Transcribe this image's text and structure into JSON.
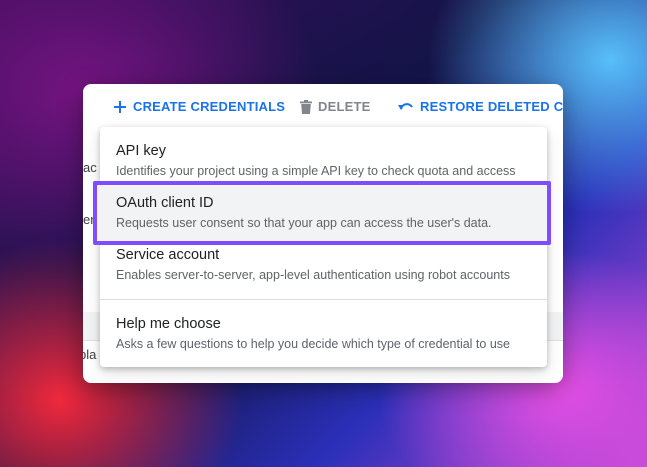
{
  "toolbar": {
    "create_label": "CREATE CREDENTIALS",
    "delete_label": "DELETE",
    "restore_label": "RESTORE DELETED CREDE"
  },
  "background": {
    "fragment_1": "ac",
    "fragment_2": "er",
    "fragment_3": "pla"
  },
  "menu": {
    "items": [
      {
        "title": "API key",
        "description": "Identifies your project using a simple API key to check quota and access"
      },
      {
        "title": "OAuth client ID",
        "description": "Requests user consent so that your app can access the user's data."
      },
      {
        "title": "Service account",
        "description": "Enables server-to-server, app-level authentication using robot accounts"
      },
      {
        "title": "Help me choose",
        "description": "Asks a few questions to help you decide which type of credential to use"
      }
    ]
  },
  "colors": {
    "accent": "#1a73e8",
    "highlight_border": "#7d4dff",
    "disabled": "#80868b"
  }
}
